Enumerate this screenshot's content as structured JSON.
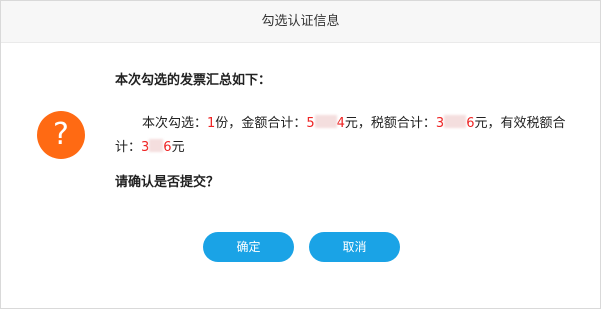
{
  "dialog": {
    "title": "勾选认证信息",
    "heading": "本次勾选的发票汇总如下：",
    "summary": {
      "label_count": "本次勾选：",
      "count": "1",
      "unit_count": "份，",
      "label_amount": "金额合计：",
      "amount_start": "5",
      "amount_end": "4",
      "unit_yuan_1": "元，",
      "label_tax": "税额合计：",
      "tax_start": "3",
      "tax_end": "6",
      "unit_yuan_2": "元，",
      "label_valid_tax": "有效税额合计：",
      "valid_tax_start": "3",
      "valid_tax_end": "6",
      "unit_yuan_3": "元"
    },
    "confirm_question": "请确认是否提交？",
    "ok_label": "确定",
    "cancel_label": "取消"
  },
  "colors": {
    "accent": "#1aa3e6",
    "icon": "#ff6a13",
    "highlight": "#ee2222"
  },
  "icons": {
    "question": "question-mark-icon"
  }
}
